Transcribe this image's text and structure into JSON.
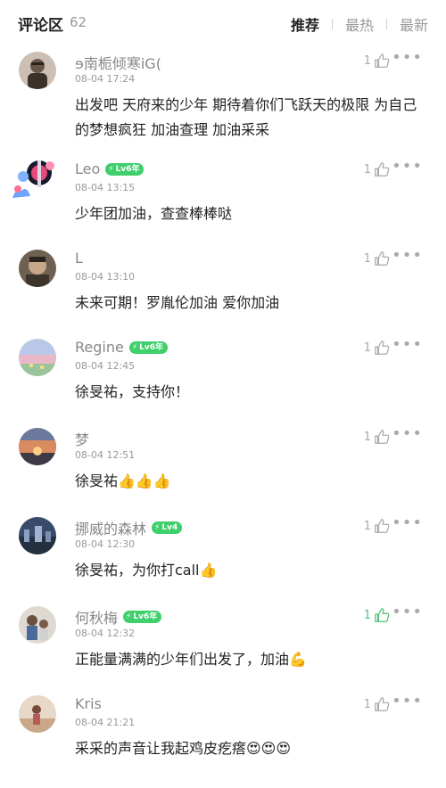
{
  "header": {
    "title": "评论区",
    "count": "62",
    "sort_options": [
      "推荐",
      "最热",
      "最新"
    ]
  },
  "colors": {
    "accent_green": "#3fcf6b",
    "like_active": "#55c07a",
    "text_gray": "#999999"
  },
  "comments": [
    {
      "name": "ɘ南栀倾寒iG(",
      "badge": "",
      "time": "08-04 17:24",
      "text": "出发吧 天府来的少年 期待着你们飞跃天的极限 为自己的梦想疯狂 加油查理 加油采采",
      "likes": "1",
      "liked": false
    },
    {
      "name": "Leo",
      "badge": "Lv6年",
      "time": "08-04 13:15",
      "text": "少年团加油，查查棒棒哒",
      "likes": "1",
      "liked": false
    },
    {
      "name": "L",
      "badge": "",
      "time": "08-04 13:10",
      "text": "未来可期！罗胤伦加油 爱你加油",
      "likes": "1",
      "liked": false
    },
    {
      "name": "Regine",
      "badge": "Lv6年",
      "time": "08-04 12:45",
      "text": "徐旻祐，支持你！",
      "likes": "1",
      "liked": false
    },
    {
      "name": "梦",
      "badge": "",
      "time": "08-04 12:51",
      "text": "徐旻祐👍👍👍",
      "likes": "1",
      "liked": false
    },
    {
      "name": "挪威的森林",
      "badge": "Lv4",
      "time": "08-04 12:30",
      "text": "徐旻祐，为你打call👍",
      "likes": "1",
      "liked": false
    },
    {
      "name": "何秋梅",
      "badge": "Lv6年",
      "time": "08-04 12:32",
      "text": "正能量满满的少年们出发了，加油💪",
      "likes": "1",
      "liked": true
    },
    {
      "name": "Kris",
      "badge": "",
      "time": "08-04 21:21",
      "text": "采采的声音让我起鸡皮疙瘩😍😍😍",
      "likes": "1",
      "liked": false
    }
  ]
}
